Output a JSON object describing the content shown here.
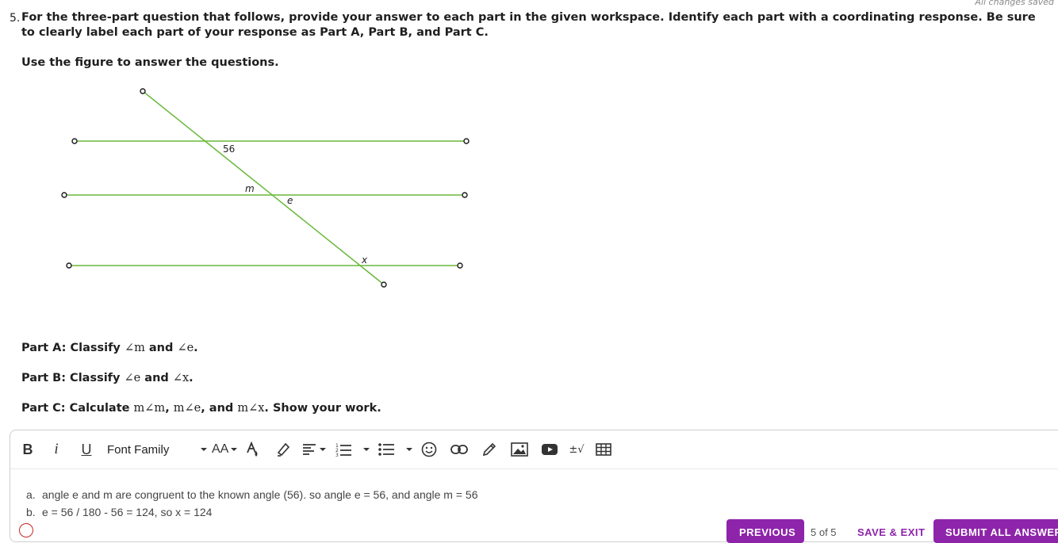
{
  "status": {
    "saved_text": "All changes saved"
  },
  "question": {
    "number": "5.",
    "prompt": "For the three-part question that follows, provide your answer to each part in the given workspace. Identify each part with a coordinating response. Be sure to clearly label each part of your response as Part A, Part B, and Part C.",
    "figure_instruction": "Use the figure to answer the questions.",
    "figure_labels": {
      "angle_value": "56",
      "angle_m": "m",
      "angle_e": "e",
      "angle_x": "x"
    },
    "part_a": {
      "prefix": "Part A: Classify ",
      "a1": "∠m",
      "mid": " and ",
      "a2": "∠e",
      "suffix": "."
    },
    "part_b": {
      "prefix": "Part B: Classify ",
      "a1": "∠e",
      "mid": " and ",
      "a2": "∠x",
      "suffix": "."
    },
    "part_c": {
      "prefix": "Part C: Calculate ",
      "a1": "m∠m",
      "sep1": ", ",
      "a2": "m∠e",
      "sep2": ", and ",
      "a3": "m∠x",
      "suffix": ". Show your work."
    }
  },
  "toolbar": {
    "bold": "B",
    "italic": "i",
    "underline": "U",
    "font_family": "Font Family",
    "font_size": "AA",
    "math": "±√"
  },
  "answer": {
    "line_a_label": "a.",
    "line_a": "angle e and m are congruent to the known angle (56). so angle e = 56, and angle m = 56",
    "line_b_label": "b.",
    "line_b": "e = 56 / 180 - 56 = 124, so x = 124"
  },
  "footer": {
    "previous": "PREVIOUS",
    "page": "5 of 5",
    "save_exit": "SAVE & EXIT",
    "submit": "SUBMIT ALL ANSWERS"
  },
  "colors": {
    "accent": "#8e24aa",
    "line": "#6ab83a"
  }
}
